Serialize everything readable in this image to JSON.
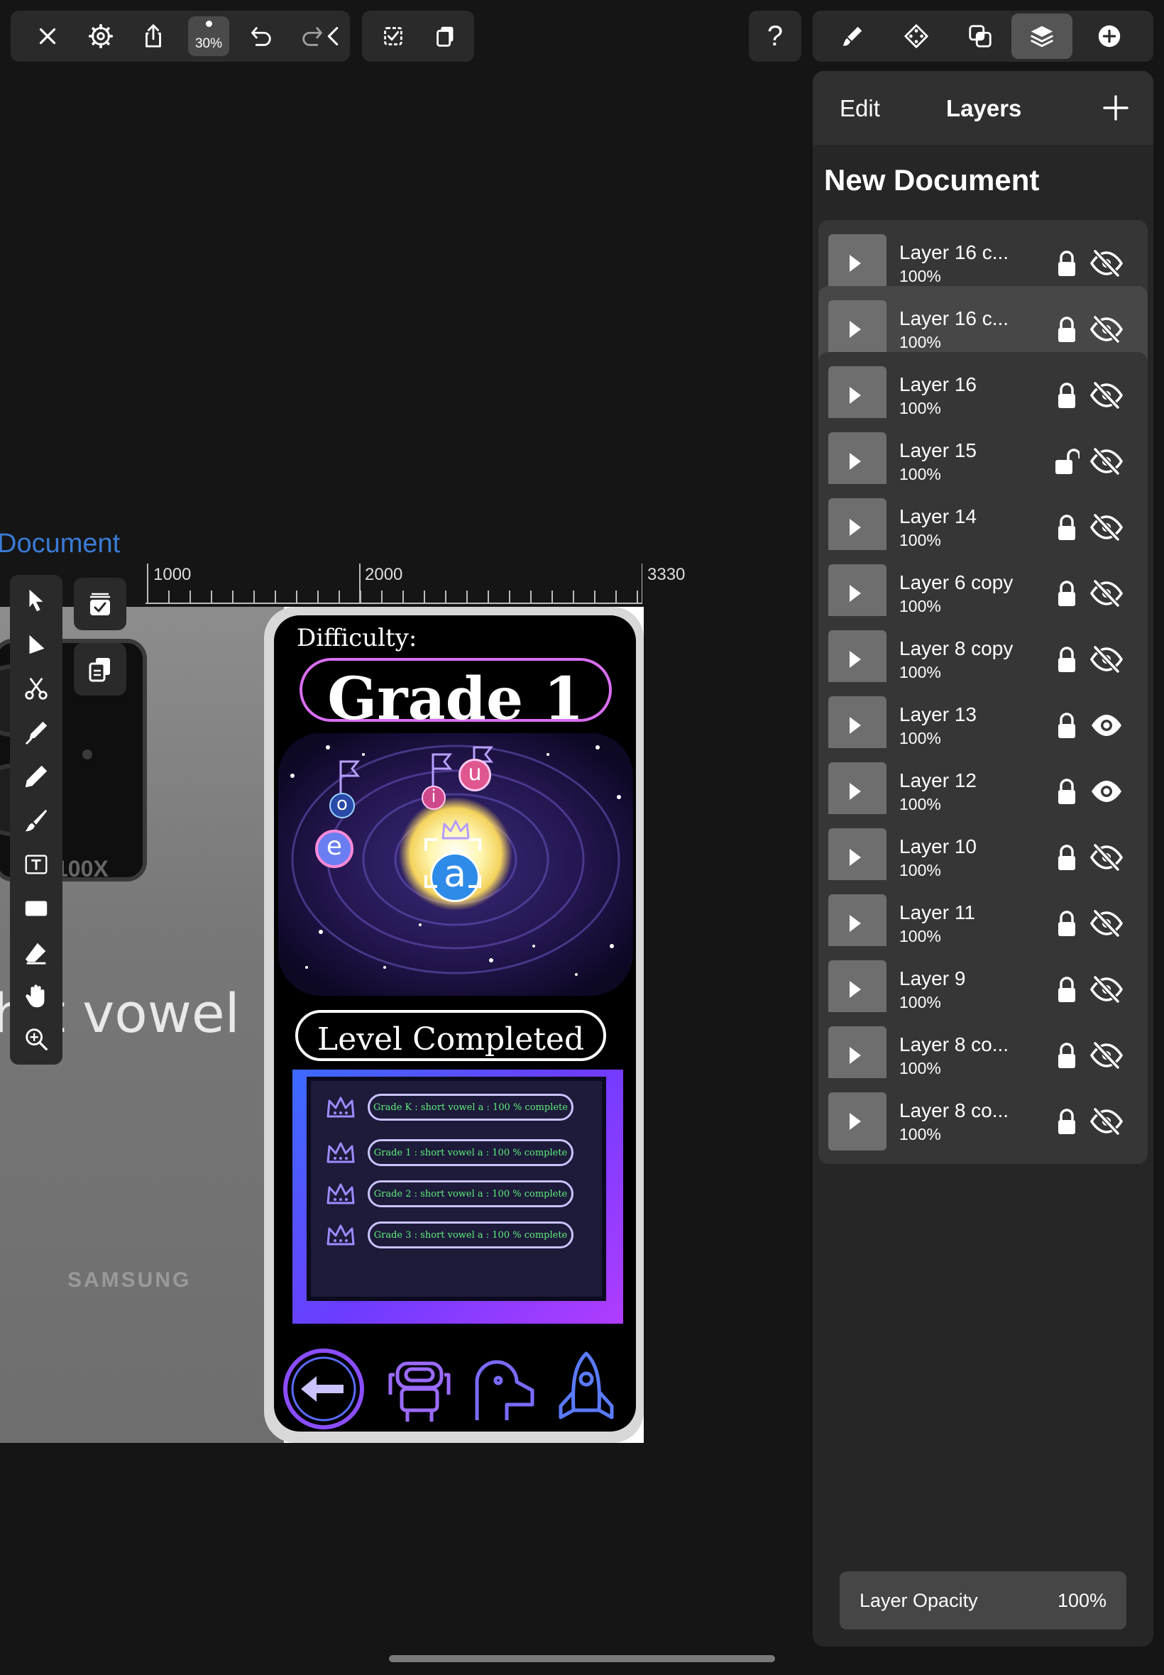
{
  "toolbar": {
    "zoom": "30%",
    "help": "?"
  },
  "panel": {
    "edit_label": "Edit",
    "layers_label": "Layers",
    "document_title": "New Document",
    "layers": [
      {
        "name": "Layer 16 c...",
        "opacity": "100%",
        "locked": true,
        "visible": false
      },
      {
        "name": "Layer 16 c...",
        "opacity": "100%",
        "locked": true,
        "visible": false,
        "selected": true
      },
      {
        "name": "Layer 16",
        "opacity": "100%",
        "locked": true,
        "visible": false
      },
      {
        "name": "Layer 15",
        "opacity": "100%",
        "locked": false,
        "visible": false
      },
      {
        "name": "Layer 14",
        "opacity": "100%",
        "locked": true,
        "visible": false
      },
      {
        "name": "Layer 6 copy",
        "opacity": "100%",
        "locked": true,
        "visible": false
      },
      {
        "name": "Layer 8 copy",
        "opacity": "100%",
        "locked": true,
        "visible": false
      },
      {
        "name": "Layer 13",
        "opacity": "100%",
        "locked": true,
        "visible": true
      },
      {
        "name": "Layer 12",
        "opacity": "100%",
        "locked": true,
        "visible": true
      },
      {
        "name": "Layer 10",
        "opacity": "100%",
        "locked": true,
        "visible": false
      },
      {
        "name": "Layer 11",
        "opacity": "100%",
        "locked": true,
        "visible": false
      },
      {
        "name": "Layer 9",
        "opacity": "100%",
        "locked": true,
        "visible": false
      },
      {
        "name": "Layer 8 co...",
        "opacity": "100%",
        "locked": true,
        "visible": false
      },
      {
        "name": "Layer 8 co...",
        "opacity": "100%",
        "locked": true,
        "visible": false
      }
    ],
    "opacity_label": "Layer Opacity",
    "opacity_value": "100%"
  },
  "canvas": {
    "document_tab": "Document",
    "ruler_labels": [
      "1000",
      "2000",
      "3330"
    ],
    "phone_back": {
      "camera_label": "100X",
      "brand": "SAMSUNG",
      "partial_text": "h t vowel"
    },
    "app_screen": {
      "difficulty_label": "Difficulty:",
      "grade_title": "Grade 1",
      "level_status": "Level Completed",
      "vowel_bubbles": [
        "o",
        "i",
        "u",
        "e",
        "a"
      ],
      "grade_progress": [
        "Grade K : short vowel a : 100 % complete",
        "Grade 1 : short vowel a : 100 % complete",
        "Grade 2 : short vowel a : 100 % complete",
        "Grade 3 : short vowel a : 100 % complete"
      ]
    }
  },
  "colors": {
    "accent_blue": "#3a7bd5",
    "panel_bg": "#262626",
    "neon_purple": "#d86ef0",
    "neon_green": "#5ef07a"
  }
}
